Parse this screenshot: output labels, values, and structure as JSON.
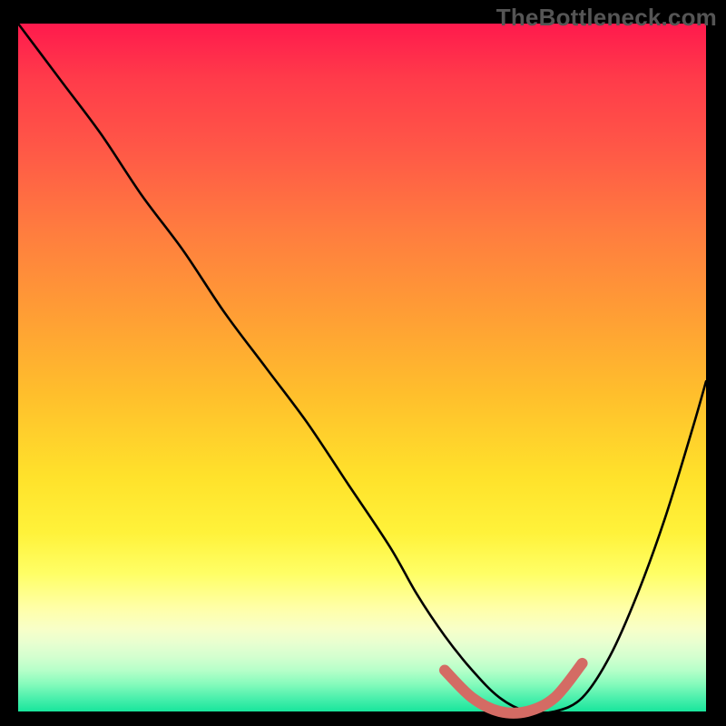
{
  "watermark": "TheBottleneck.com",
  "chart_data": {
    "type": "line",
    "title": "",
    "xlabel": "",
    "ylabel": "",
    "xlim": [
      0,
      100
    ],
    "ylim": [
      0,
      100
    ],
    "grid": false,
    "series": [
      {
        "name": "bottleneck-curve",
        "x": [
          0,
          6,
          12,
          18,
          24,
          30,
          36,
          42,
          48,
          54,
          58,
          62,
          66,
          70,
          74,
          78,
          82,
          86,
          90,
          94,
          98,
          100
        ],
        "values": [
          100,
          92,
          84,
          75,
          67,
          58,
          50,
          42,
          33,
          24,
          17,
          11,
          6,
          2,
          0,
          0,
          2,
          8,
          17,
          28,
          41,
          48
        ]
      },
      {
        "name": "optimal-range-highlight",
        "x": [
          62,
          66,
          70,
          74,
          78,
          82
        ],
        "values": [
          6,
          2,
          0,
          0,
          2,
          7
        ]
      }
    ],
    "background_gradient": {
      "orientation": "vertical",
      "stops": [
        {
          "pos": 0.0,
          "color": "#ff1a4d"
        },
        {
          "pos": 0.3,
          "color": "#ff7c3f"
        },
        {
          "pos": 0.6,
          "color": "#ffe22b"
        },
        {
          "pos": 0.85,
          "color": "#ffffa8"
        },
        {
          "pos": 1.0,
          "color": "#18e59c"
        }
      ]
    }
  }
}
